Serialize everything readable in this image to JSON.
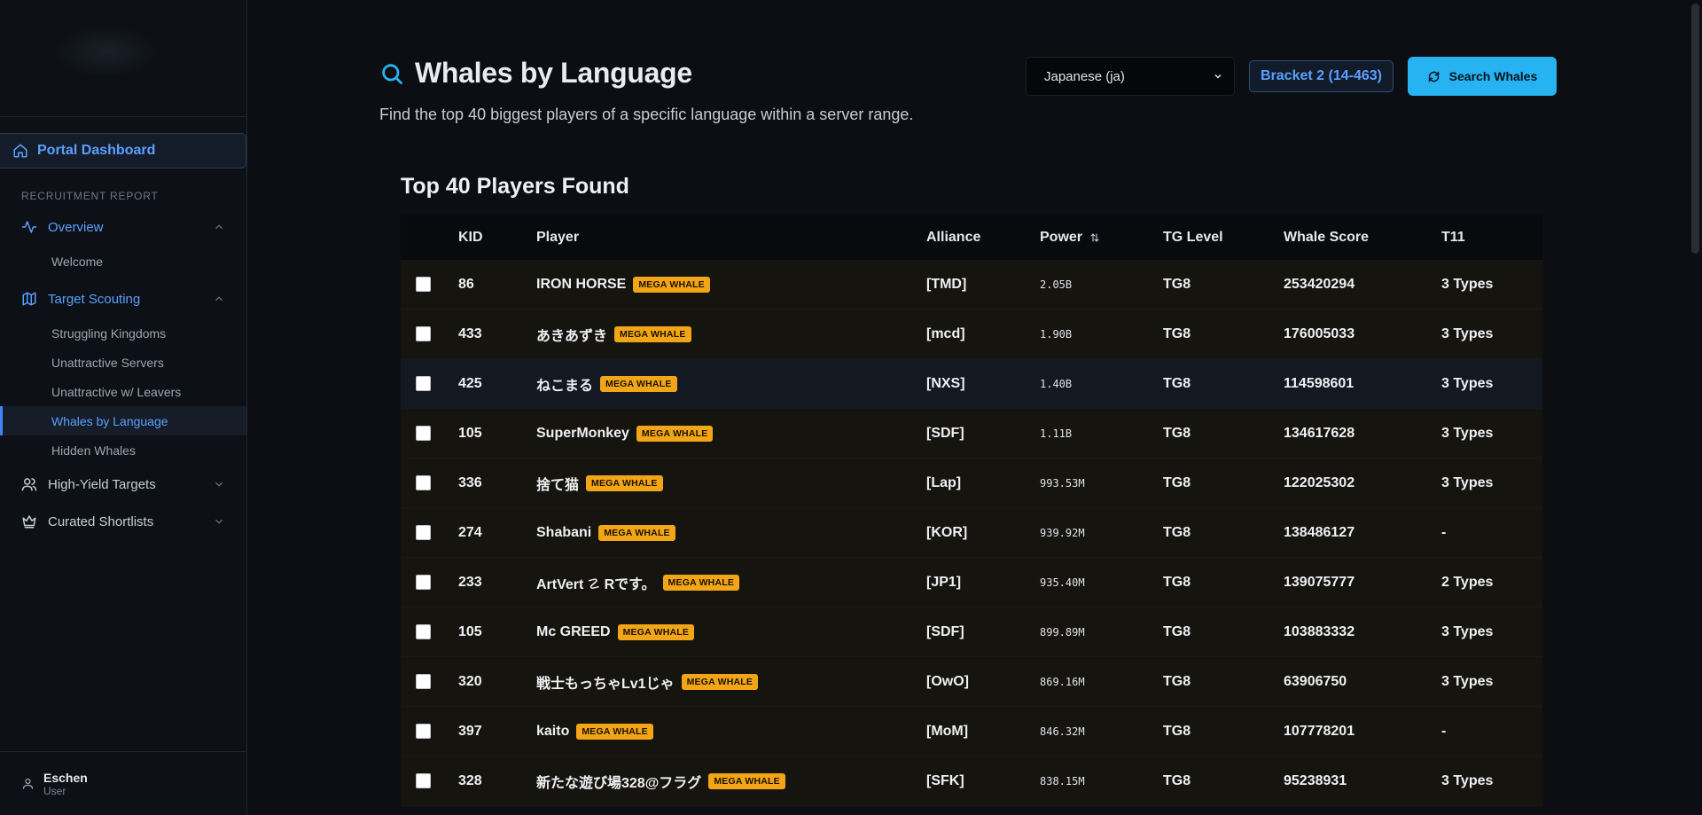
{
  "sidebar": {
    "dashboard_label": "Portal Dashboard",
    "section_label": "RECRUITMENT REPORT",
    "groups": [
      {
        "label": "Overview",
        "state": "expanded",
        "items": [
          "Welcome"
        ]
      },
      {
        "label": "Target Scouting",
        "state": "expanded",
        "items": [
          "Struggling Kingdoms",
          "Unattractive Servers",
          "Unattractive w/ Leavers",
          "Whales by Language",
          "Hidden Whales"
        ]
      },
      {
        "label": "High-Yield Targets",
        "state": "collapsed"
      },
      {
        "label": "Curated Shortlists",
        "state": "collapsed"
      }
    ],
    "selected_item": "Whales by Language",
    "user": {
      "name": "Eschen",
      "role": "User"
    }
  },
  "header": {
    "title": "Whales by Language",
    "subtitle": "Find the top 40 biggest players of a specific language within a server range.",
    "language_selected": "Japanese (ja)",
    "bracket_label": "Bracket 2 (14-463)",
    "search_label": "Search Whales"
  },
  "table": {
    "title": "Top 40 Players Found",
    "columns": {
      "kid": "KID",
      "player": "Player",
      "alliance": "Alliance",
      "power": "Power",
      "tg": "TG Level",
      "score": "Whale Score",
      "t11": "T11"
    },
    "badge_label": "MEGA WHALE",
    "rows": [
      {
        "kid": "86",
        "player": "IRON HORSE",
        "alliance": "[TMD]",
        "power": "2.05B",
        "tg": "TG8",
        "score": "253420294",
        "t11": "3 Types"
      },
      {
        "kid": "433",
        "player": "あきあずき",
        "alliance": "[mcd]",
        "power": "1.90B",
        "tg": "TG8",
        "score": "176005033",
        "t11": "3 Types"
      },
      {
        "kid": "425",
        "player": "ねこまる",
        "alliance": "[NXS]",
        "power": "1.40B",
        "tg": "TG8",
        "score": "114598601",
        "t11": "3 Types"
      },
      {
        "kid": "105",
        "player": "SuperMonkey",
        "alliance": "[SDF]",
        "power": "1.11B",
        "tg": "TG8",
        "score": "134617628",
        "t11": "3 Types"
      },
      {
        "kid": "336",
        "player": "捨て猫",
        "alliance": "[Lap]",
        "power": "993.53M",
        "tg": "TG8",
        "score": "122025302",
        "t11": "3 Types"
      },
      {
        "kid": "274",
        "player": "Shabani",
        "alliance": "[KOR]",
        "power": "939.92M",
        "tg": "TG8",
        "score": "138486127",
        "t11": "-"
      },
      {
        "kid": "233",
        "player": "ArtVert ☡ Rです。",
        "alliance": "[JP1]",
        "power": "935.40M",
        "tg": "TG8",
        "score": "139075777",
        "t11": "2 Types"
      },
      {
        "kid": "105",
        "player": "Mc GREED",
        "alliance": "[SDF]",
        "power": "899.89M",
        "tg": "TG8",
        "score": "103883332",
        "t11": "3 Types"
      },
      {
        "kid": "320",
        "player": "戦士もっちゃLv1じゃ",
        "alliance": "[OwO]",
        "power": "869.16M",
        "tg": "TG8",
        "score": "63906750",
        "t11": "3 Types"
      },
      {
        "kid": "397",
        "player": "kaito",
        "alliance": "[MoM]",
        "power": "846.32M",
        "tg": "TG8",
        "score": "107778201",
        "t11": "-"
      },
      {
        "kid": "328",
        "player": "新たな遊び場328@フラグ",
        "alliance": "[SFK]",
        "power": "838.15M",
        "tg": "TG8",
        "score": "95238931",
        "t11": "3 Types"
      }
    ]
  },
  "colors": {
    "accent": "#5aa0ff",
    "button": "#27b3f1",
    "badge": "#f2a516",
    "background": "#0c0e13"
  }
}
